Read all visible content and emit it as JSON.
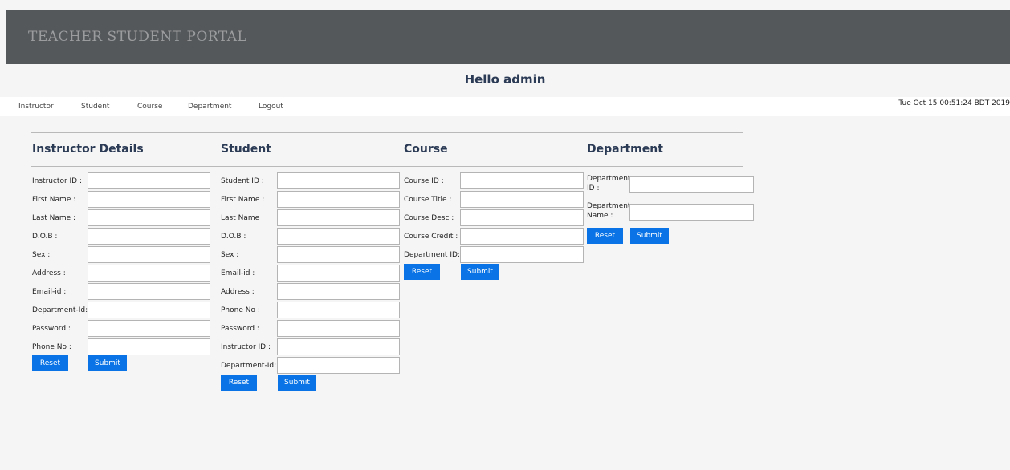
{
  "header": {
    "title": "TEACHER STUDENT PORTAL"
  },
  "greeting": "Hello admin",
  "nav": {
    "items": [
      "Instructor",
      "Student",
      "Course",
      "Department",
      "Logout"
    ]
  },
  "datetime": "Tue Oct 15 00:51:24 BDT 2019",
  "instructor": {
    "title": "Instructor Details",
    "fields": [
      "Instructor ID :",
      "First Name :",
      "Last Name :",
      "D.O.B :",
      "Sex :",
      "Address :",
      "Email-id :",
      "Department-Id:",
      "Password :",
      "Phone No :"
    ],
    "reset": "Reset",
    "submit": "Submit"
  },
  "student": {
    "title": "Student",
    "fields": [
      "Student ID :",
      "First Name :",
      "Last Name :",
      "D.O.B :",
      "Sex :",
      "Email-id :",
      "Address :",
      "Phone No :",
      "Password :",
      "Instructor ID :",
      "Department-Id:"
    ],
    "reset": "Reset",
    "submit": "Submit"
  },
  "course": {
    "title": "Course",
    "fields": [
      "Course ID :",
      "Course Title :",
      "Course Desc :",
      "Course Credit :",
      "Department ID:"
    ],
    "reset": "Reset",
    "submit": "Submit"
  },
  "department": {
    "title": "Department",
    "fields": [
      {
        "line1": "Department",
        "line2": "ID :"
      },
      {
        "line1": "Department",
        "line2": "Name :"
      }
    ],
    "reset": "Reset",
    "submit": "Submit"
  }
}
